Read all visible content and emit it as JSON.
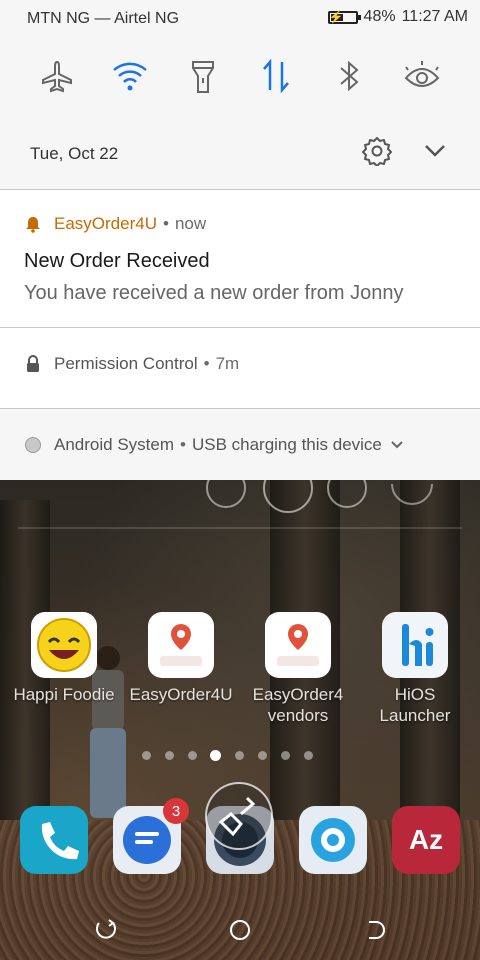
{
  "status_bar": {
    "carriers": "MTN NG — Airtel NG",
    "battery_percent": "48%",
    "battery_level": 0.48,
    "time": "11:27 AM"
  },
  "quick_settings": {
    "tiles": [
      {
        "icon": "airplane-icon",
        "active": false
      },
      {
        "icon": "wifi-icon",
        "active": true
      },
      {
        "icon": "flashlight-icon",
        "active": false
      },
      {
        "icon": "mobile-data-icon",
        "active": true
      },
      {
        "icon": "bluetooth-icon",
        "active": false
      },
      {
        "icon": "eye-care-icon",
        "active": false
      }
    ],
    "date": "Tue, Oct 22"
  },
  "notifications": [
    {
      "app": "EasyOrder4U",
      "time": "now",
      "title": "New Order Received",
      "text": "You have received a new order from Jonny",
      "icon": "bell-icon",
      "accent": "#c56b00"
    },
    {
      "app": "Permission Control",
      "time": "7m",
      "icon": "lock-icon"
    },
    {
      "app": "Android System",
      "summary": "USB charging this device",
      "icon": "system-dot-icon"
    }
  ],
  "separator": "•",
  "home": {
    "apps": [
      {
        "label": "Happi Foodie"
      },
      {
        "label": "EasyOrder4U"
      },
      {
        "label": "EasyOrder4 vendors"
      },
      {
        "label": "HiOS Launcher"
      }
    ],
    "page_dots": 8,
    "active_page": 3,
    "dock": [
      {
        "icon": "phone-icon"
      },
      {
        "icon": "messages-icon",
        "badge": "3"
      },
      {
        "icon": "cleaner-icon"
      },
      {
        "icon": "browser-icon"
      },
      {
        "icon": "translator-icon",
        "label": "Az"
      }
    ]
  },
  "colors": {
    "active_tile": "#1a73e8",
    "inactive_tile": "#666666",
    "shade_bg": "#f6f6f6"
  }
}
